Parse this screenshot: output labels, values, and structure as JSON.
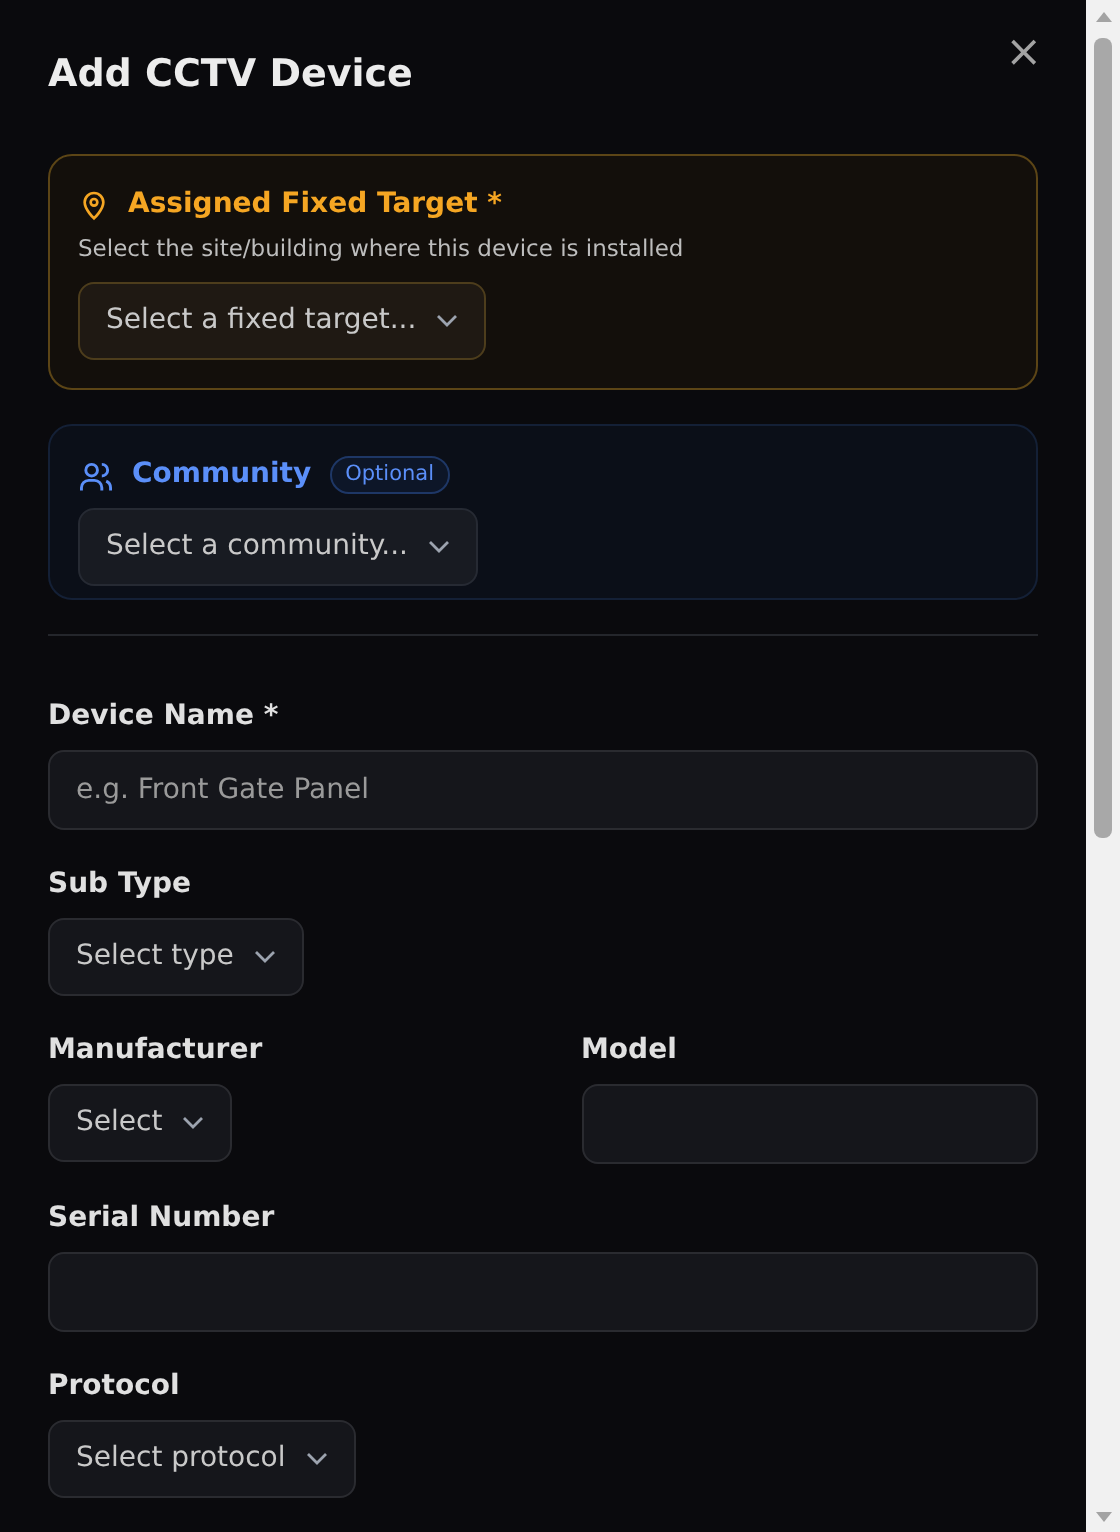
{
  "dialog": {
    "title": "Add CCTV Device",
    "close": "×"
  },
  "fixed_target": {
    "title": "Assigned Fixed Target *",
    "description": "Select the site/building where this device is installed",
    "select": "Select a fixed target..."
  },
  "community": {
    "title": "Community",
    "badge": "Optional",
    "select": "Select a community..."
  },
  "rows": [
    [
      {
        "kind": "input",
        "label": "Device Name *",
        "placeholder": "e.g. Front Gate Panel"
      }
    ],
    [
      {
        "kind": "select",
        "label": "Sub Type",
        "value": "Select type"
      }
    ],
    [
      {
        "kind": "select",
        "label": "Manufacturer",
        "value": "Select"
      },
      {
        "kind": "input",
        "label": "Model"
      }
    ],
    [
      {
        "kind": "input",
        "label": "Serial Number"
      }
    ],
    [
      {
        "kind": "select",
        "label": "Protocol",
        "value": "Select protocol"
      }
    ]
  ]
}
